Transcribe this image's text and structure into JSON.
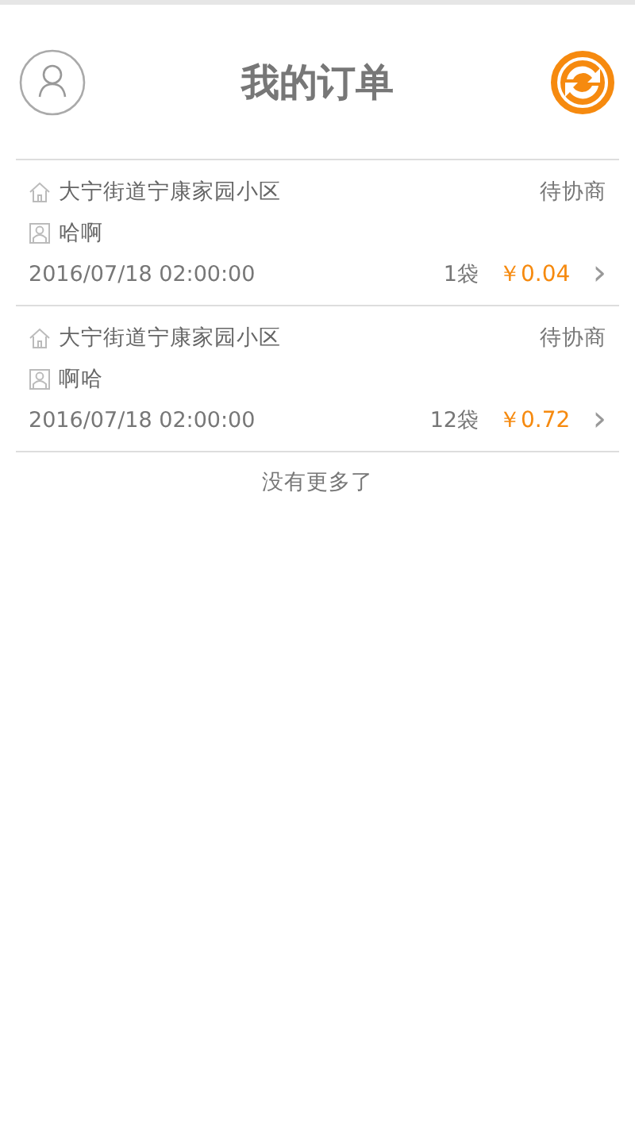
{
  "header": {
    "title": "我的订单"
  },
  "orders": [
    {
      "address": "大宁街道宁康家园小区",
      "status": "待协商",
      "name": "哈啊",
      "time": "2016/07/18 02:00:00",
      "quantity": "1袋",
      "price": "￥0.04",
      "chevron": "›"
    },
    {
      "address": "大宁街道宁康家园小区",
      "status": "待协商",
      "name": "啊哈",
      "time": "2016/07/18 02:00:00",
      "quantity": "12袋",
      "price": "￥0.72",
      "chevron": "›"
    }
  ],
  "footer": "没有更多了"
}
